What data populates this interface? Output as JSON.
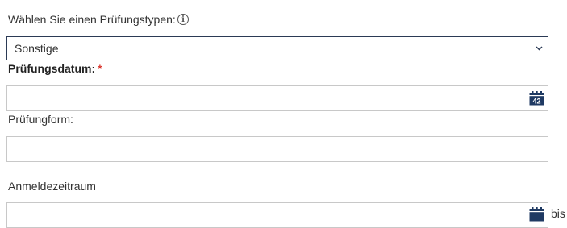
{
  "exam_type": {
    "label": "Wählen Sie einen Prüfungstypen:",
    "info_icon": "info-icon",
    "selected": "Sonstige"
  },
  "exam_date": {
    "label": "Prüfungsdatum:",
    "required_marker": "*",
    "value": "",
    "calendar_icon_number": "42"
  },
  "exam_form": {
    "label": "Prüfungform:",
    "value": ""
  },
  "registration_period": {
    "label": "Anmeldezeitraum",
    "start_value": "",
    "to_label": "bis"
  },
  "colors": {
    "select_border": "#2b3a55",
    "field_border": "#c8c8c8",
    "required": "#d9342b",
    "calendar_icon": "#1f3a63"
  }
}
